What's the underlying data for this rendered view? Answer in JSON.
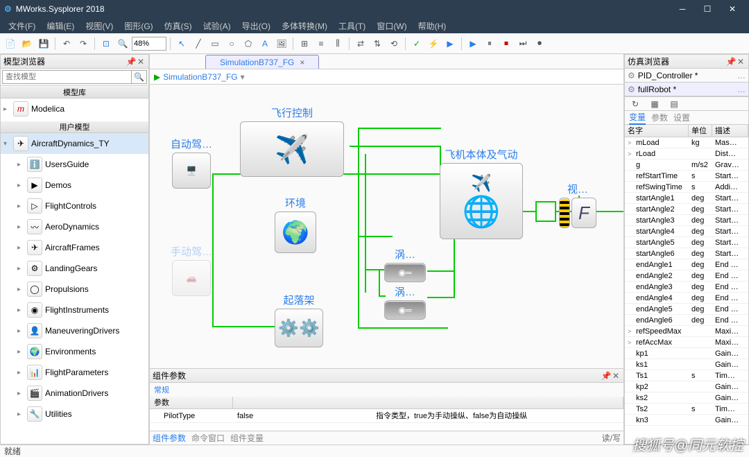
{
  "app": {
    "title": "MWorks.Sysplorer 2018"
  },
  "menu": [
    "文件(F)",
    "编辑(E)",
    "视图(V)",
    "图形(G)",
    "仿真(S)",
    "试验(A)",
    "导出(O)",
    "多体转换(M)",
    "工具(T)",
    "窗口(W)",
    "帮助(H)"
  ],
  "toolbar": {
    "zoom": "48%"
  },
  "modelBrowser": {
    "title": "模型浏览器",
    "searchPlaceholder": "查找模型",
    "libHeader": "模型库",
    "userHeader": "用户模型",
    "lib": [
      {
        "name": "Modelica"
      }
    ],
    "user": [
      {
        "name": "AircraftDynamics_TY",
        "top": true
      },
      {
        "name": "UsersGuide",
        "icon": "info"
      },
      {
        "name": "Demos",
        "icon": "play"
      },
      {
        "name": "FlightControls",
        "icon": "ctrl"
      },
      {
        "name": "AeroDynamics",
        "icon": "aero"
      },
      {
        "name": "AircraftFrames",
        "icon": "frame"
      },
      {
        "name": "LandingGears",
        "icon": "gear"
      },
      {
        "name": "Propulsions",
        "icon": "prop"
      },
      {
        "name": "FlightInstruments",
        "icon": "instr"
      },
      {
        "name": "ManeuveringDrivers",
        "icon": "driver"
      },
      {
        "name": "Environments",
        "icon": "env"
      },
      {
        "name": "FlightParameters",
        "icon": "param"
      },
      {
        "name": "AnimationDrivers",
        "icon": "anim"
      },
      {
        "name": "Utilities",
        "icon": "util"
      }
    ]
  },
  "tabs": {
    "active": "SimulationB737_FG"
  },
  "breadcrumb": "SimulationB737_FG",
  "blocks": {
    "autopilot": "自动驾…",
    "manual": "手动驾…",
    "flightctrl": "飞行控制",
    "env": "环境",
    "gear": "起落架",
    "turbine1": "涡…",
    "turbine2": "涡…",
    "body": "飞机本体及气动",
    "vis": "视…"
  },
  "componentParams": {
    "title": "组件参数",
    "tab": "常规",
    "col": "参数",
    "rows": [
      {
        "name": "PilotType",
        "value": "false",
        "desc": "指令类型，true为手动操纵、false为自动操纵"
      }
    ],
    "bottomTabs": [
      "组件参数",
      "命令窗口",
      "组件变量"
    ],
    "rw": "读/写"
  },
  "simBrowser": {
    "title": "仿真浏览器",
    "sessions": [
      "PID_Controller *",
      "fullRobot *"
    ],
    "subtabs": [
      "变量",
      "参数",
      "设置"
    ],
    "cols": [
      "名字",
      "单位",
      "描述"
    ],
    "vars": [
      {
        "n": "mLoad",
        "u": "kg",
        "d": "Mas…",
        "e": ">"
      },
      {
        "n": "rLoad",
        "u": "",
        "d": "Dist…",
        "e": ">"
      },
      {
        "n": "g",
        "u": "m/s2",
        "d": "Grav…"
      },
      {
        "n": "refStartTime",
        "u": "s",
        "d": "Start…"
      },
      {
        "n": "refSwingTime",
        "u": "s",
        "d": "Addi…"
      },
      {
        "n": "startAngle1",
        "u": "deg",
        "d": "Start…"
      },
      {
        "n": "startAngle2",
        "u": "deg",
        "d": "Start…"
      },
      {
        "n": "startAngle3",
        "u": "deg",
        "d": "Start…"
      },
      {
        "n": "startAngle4",
        "u": "deg",
        "d": "Start…"
      },
      {
        "n": "startAngle5",
        "u": "deg",
        "d": "Start…"
      },
      {
        "n": "startAngle6",
        "u": "deg",
        "d": "Start…"
      },
      {
        "n": "endAngle1",
        "u": "deg",
        "d": "End …"
      },
      {
        "n": "endAngle2",
        "u": "deg",
        "d": "End …"
      },
      {
        "n": "endAngle3",
        "u": "deg",
        "d": "End …"
      },
      {
        "n": "endAngle4",
        "u": "deg",
        "d": "End …"
      },
      {
        "n": "endAngle5",
        "u": "deg",
        "d": "End …"
      },
      {
        "n": "endAngle6",
        "u": "deg",
        "d": "End …"
      },
      {
        "n": "refSpeedMax",
        "u": "",
        "d": "Maxi…",
        "e": ">"
      },
      {
        "n": "refAccMax",
        "u": "",
        "d": "Maxi…",
        "e": ">"
      },
      {
        "n": "kp1",
        "u": "",
        "d": "Gain…"
      },
      {
        "n": "ks1",
        "u": "",
        "d": "Gain…"
      },
      {
        "n": "Ts1",
        "u": "s",
        "d": "Tim…"
      },
      {
        "n": "kp2",
        "u": "",
        "d": "Gain…"
      },
      {
        "n": "ks2",
        "u": "",
        "d": "Gain…"
      },
      {
        "n": "Ts2",
        "u": "s",
        "d": "Tim…"
      },
      {
        "n": "kn3",
        "u": "",
        "d": "Gain…"
      }
    ]
  },
  "status": "就绪",
  "watermark": "搜狐号@同元软控"
}
